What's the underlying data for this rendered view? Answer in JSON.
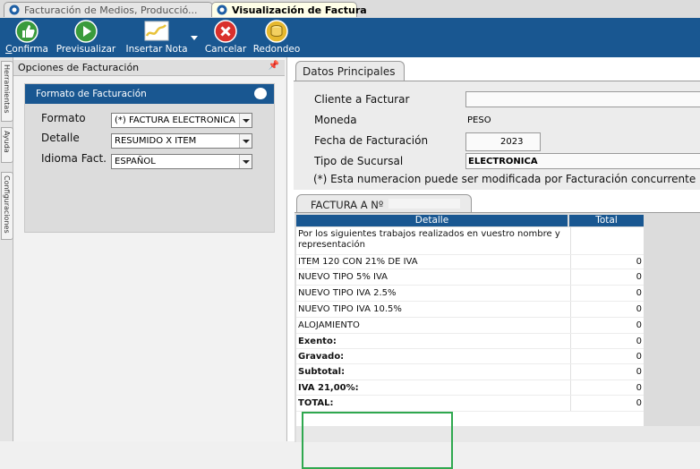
{
  "tabs": [
    {
      "label": "Facturación de Medios, Producció...",
      "close": "✕"
    },
    {
      "label": "Visualización de Factura",
      "close": "✕"
    }
  ],
  "toolbar": {
    "confirma": {
      "mnemonic": "C",
      "rest": "onfirma"
    },
    "previsualizar": "Previsualizar",
    "insertar_nota": "Insertar Nota",
    "cancelar": "Cancelar",
    "redondeo": "Redondeo"
  },
  "side_tabs": [
    "Herramientas",
    "Ayuda",
    "Configuraciones"
  ],
  "left_panel": {
    "title": "Opciones de Facturación",
    "pin": "📌",
    "section_title": "Formato de Facturación",
    "fields": [
      {
        "label": "Formato",
        "value": "(*) FACTURA ELECTRONICA"
      },
      {
        "label": "Detalle",
        "value": "RESUMIDO X ITEM"
      },
      {
        "label": "Idioma Fact.",
        "value": "ESPAÑOL"
      }
    ]
  },
  "datos": {
    "tab": "Datos Principales",
    "cliente_label": "Cliente a Facturar",
    "moneda_label": "Moneda",
    "moneda_value": "PESO",
    "fecha_label": "Fecha de Facturación",
    "fecha_value": "2023",
    "sucursal_label": "Tipo de Sucursal",
    "sucursal_value": "ELECTRONICA",
    "note": "(*) Esta numeracion puede ser modificada por Facturación concurrente"
  },
  "factura": {
    "tab": "FACTURA A Nº",
    "col_detalle": "Detalle",
    "col_total": "Total",
    "rows": [
      {
        "detalle": "Por los siguientes trabajos realizados en vuestro nombre y representación",
        "total": "",
        "bold": false
      },
      {
        "detalle": "ITEM 120 CON 21% DE IVA",
        "total": "0",
        "bold": false
      },
      {
        "detalle": "NUEVO TIPO 5% IVA",
        "total": "0",
        "bold": false
      },
      {
        "detalle": "NUEVO TIPO IVA 2.5%",
        "total": "0",
        "bold": false
      },
      {
        "detalle": "NUEVO TIPO IVA 10.5%",
        "total": "0",
        "bold": false
      },
      {
        "detalle": "ALOJAMIENTO",
        "total": "0",
        "bold": false
      },
      {
        "detalle": "Exento:",
        "total": "0",
        "bold": true
      },
      {
        "detalle": "Gravado:",
        "total": "0",
        "bold": true
      },
      {
        "detalle": "Subtotal:",
        "total": "0",
        "bold": true
      },
      {
        "detalle": "IVA 21,00%:",
        "total": "0",
        "bold": true
      },
      {
        "detalle": "TOTAL:",
        "total": "0",
        "bold": true
      }
    ]
  },
  "colors": {
    "toolbar": "#195791",
    "header": "#195791",
    "highlight": "#2fa84f",
    "tab_active": "#ffffe8"
  }
}
